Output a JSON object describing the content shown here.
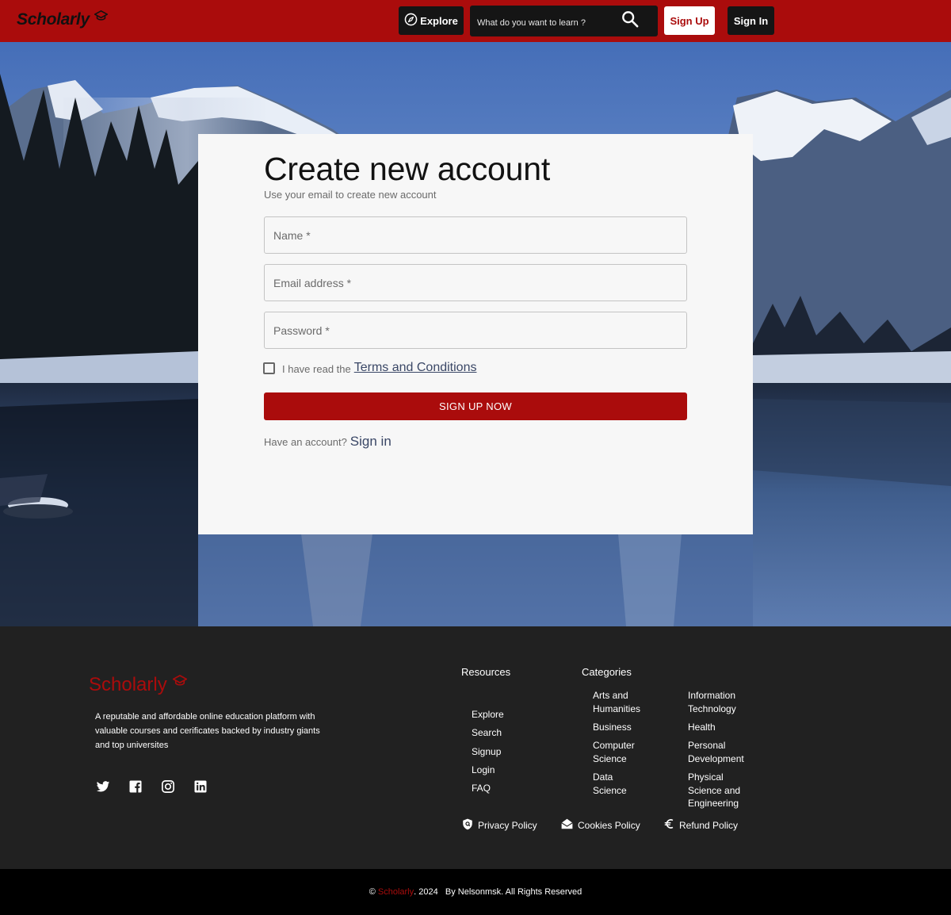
{
  "header": {
    "logo": "Scholarly",
    "explore_label": "Explore",
    "search_placeholder": "What do you want to learn ?",
    "signup_label": "Sign Up",
    "signin_label": "Sign In"
  },
  "form": {
    "title": "Create new account",
    "subtitle": "Use your email to create new account",
    "name_placeholder": "Name *",
    "email_placeholder": "Email address *",
    "password_placeholder": "Password *",
    "terms_prefix": "I have read the",
    "terms_link": "Terms and Conditions",
    "submit_label": "SIGN UP NOW",
    "have_account": "Have an account?",
    "signin_link": "Sign in"
  },
  "footer": {
    "logo": "Scholarly",
    "description": "A reputable and affordable online education platform with valuable courses and cerificates backed by industry giants and top universites",
    "resources_title": "Resources",
    "resources": [
      "Explore",
      "Search",
      "Signup",
      "Login",
      "FAQ"
    ],
    "categories_title": "Categories",
    "categories": [
      "Arts and Humanities",
      "Business",
      "Computer Science",
      "Data Science",
      "Information Technology",
      "Health",
      "Personal Development",
      "Physical Science and Engineering"
    ],
    "policies": [
      "Privacy Policy",
      "Cookies Policy",
      "Refund Policy"
    ],
    "socials": [
      "twitter-icon",
      "facebook-icon",
      "instagram-icon",
      "linkedin-icon"
    ]
  },
  "copyright": {
    "symbol": "©",
    "brand": "Scholarly",
    "rest": ". 2024   By Nelsonmsk. All Rights Reserved"
  },
  "colors": {
    "brand_red": "#aa0c0c",
    "dark": "#151515",
    "footer_bg": "#212121"
  }
}
